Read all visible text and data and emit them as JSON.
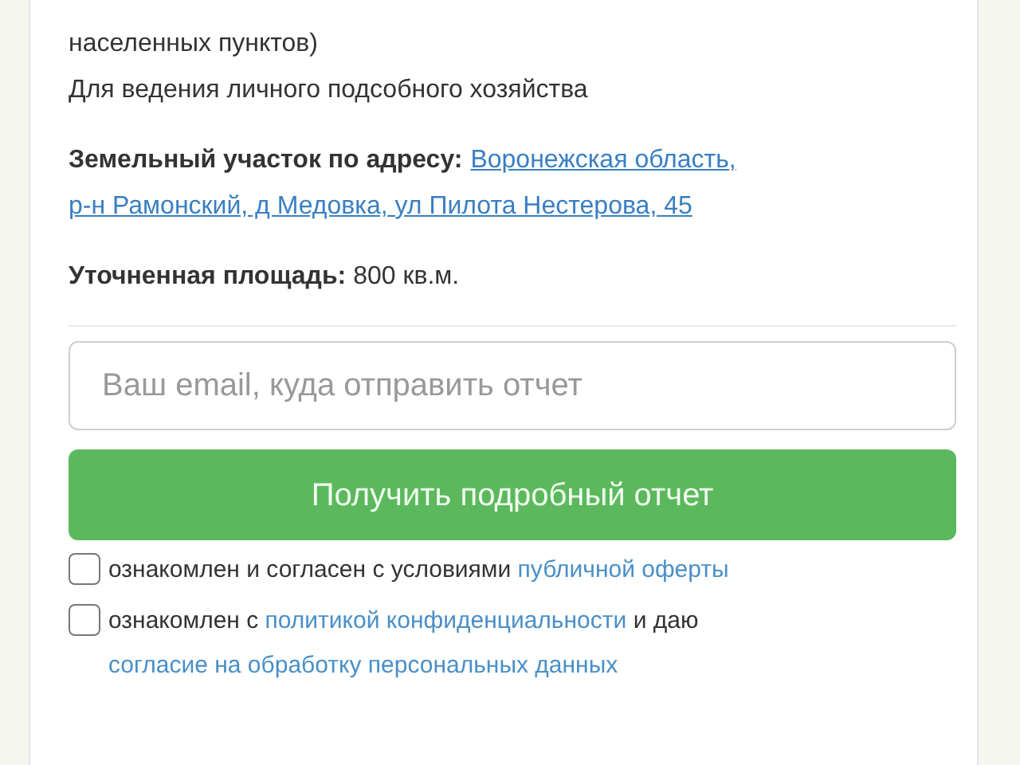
{
  "land_category_continued": "населенных пунктов)",
  "permitted_use": "Для ведения личного подсобного хозяйства",
  "address": {
    "label": "Земельный участок по адресу:",
    "link_lines": [
      "Воронежская область,",
      "р-н Рамонский, д Медовка, ул Пилота Нестерова, 45"
    ]
  },
  "area": {
    "label": "Уточненная площадь:",
    "value": "800 кв.м."
  },
  "email_field": {
    "placeholder": "Ваш email, куда отправить отчет"
  },
  "submit_button": "Получить подробный отчет",
  "agreements": [
    {
      "checked": false,
      "parts": [
        {
          "kind": "text",
          "text": "ознакомлен и согласен с условиями"
        },
        {
          "kind": "link",
          "text": "публичной оферты"
        }
      ]
    },
    {
      "checked": false,
      "parts": [
        {
          "kind": "text",
          "text": "ознакомлен с"
        },
        {
          "kind": "link",
          "text": "политикой конфиденциальности"
        },
        {
          "kind": "text",
          "text": "и даю"
        },
        {
          "kind": "link",
          "text": "согласие на обработку персональных данных"
        }
      ]
    }
  ]
}
